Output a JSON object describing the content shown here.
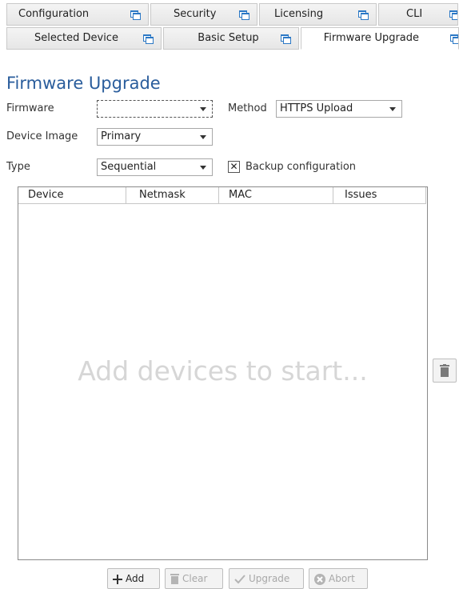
{
  "tabs_top": [
    {
      "label": "Configuration"
    },
    {
      "label": "Security"
    },
    {
      "label": "Licensing"
    },
    {
      "label": "CLI"
    }
  ],
  "tabs_sub": [
    {
      "label": "Selected Device"
    },
    {
      "label": "Basic Setup"
    },
    {
      "label": "Firmware Upgrade"
    }
  ],
  "page_title": "Firmware Upgrade",
  "form": {
    "firmware_label": "Firmware",
    "firmware_value": "",
    "method_label": "Method",
    "method_value": "HTTPS Upload",
    "device_image_label": "Device Image",
    "device_image_value": "Primary",
    "type_label": "Type",
    "type_value": "Sequential",
    "backup_label": "Backup configuration",
    "backup_checked": "✕"
  },
  "table": {
    "columns": [
      "Device",
      "Netmask",
      "MAC",
      "Issues"
    ],
    "placeholder": "Add devices to start..."
  },
  "buttons": {
    "add": "Add",
    "clear": "Clear",
    "upgrade": "Upgrade",
    "abort": "Abort"
  },
  "icons": {
    "tab": "window-popout-icon",
    "delete": "trash-icon",
    "add": "plus-icon",
    "clear": "trash-icon",
    "upgrade": "checkmark-icon",
    "abort": "x-circle-icon"
  },
  "colors": {
    "title": "#2a5d9c",
    "tab_icon": "#2b78c5",
    "placeholder": "#d6d6d6",
    "disabled_text": "#a8a8a8"
  }
}
